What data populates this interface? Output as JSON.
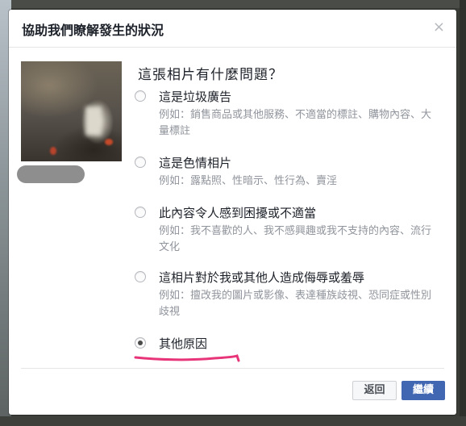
{
  "dialog": {
    "title": "協助我們瞭解發生的狀況",
    "close_icon": "×"
  },
  "question": "這張相片有什麼問題？",
  "options": [
    {
      "label": "這是垃圾廣告",
      "example": "例如：銷售商品或其他服務、不適當的標註、購物內容、大量標註",
      "checked": false
    },
    {
      "label": "這是色情相片",
      "example": "例如：露點照、性暗示、性行為、賣淫",
      "checked": false
    },
    {
      "label": "此內容令人感到困擾或不適當",
      "example": "例如：我不喜歡的人、我不感興趣或我不支持的內容、流行文化",
      "checked": false
    },
    {
      "label": "這相片對於我或其他人造成侮辱或羞辱",
      "example": "例如：擅改我的圖片或影像、表達種族歧視、恐同症或性別歧視",
      "checked": false
    },
    {
      "label": "其他原因",
      "example": "",
      "checked": true
    }
  ],
  "buttons": {
    "back": "返回",
    "continue": "繼續"
  },
  "colors": {
    "primary": "#4267b2",
    "annotation": "#e8357a"
  }
}
